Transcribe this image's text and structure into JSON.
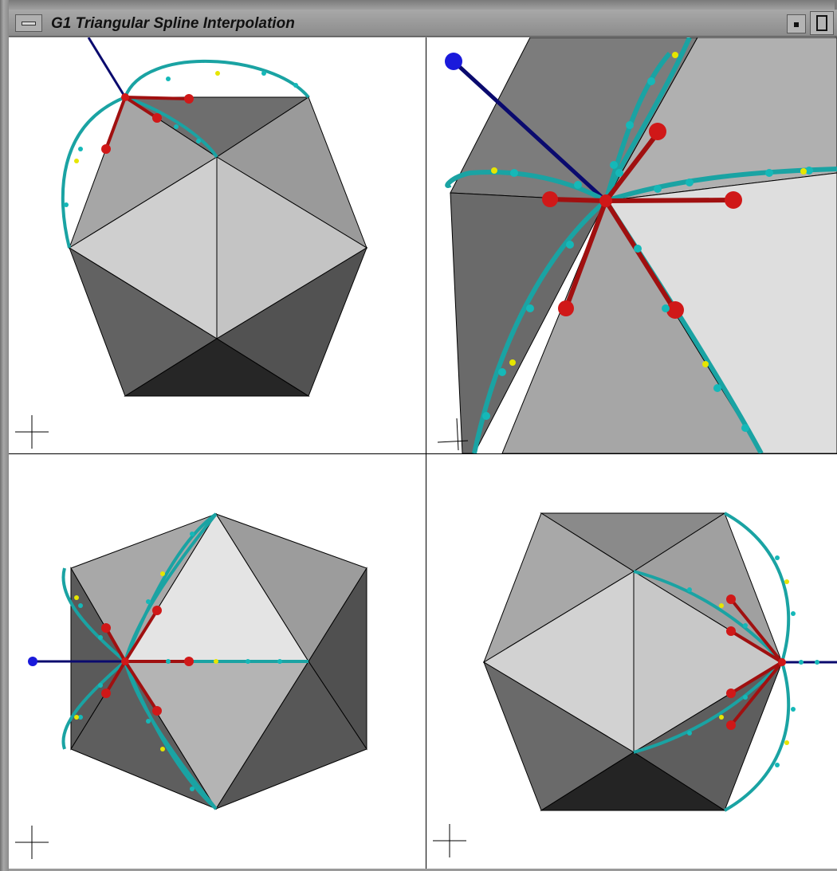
{
  "window": {
    "title": "G1 Triangular Spline Interpolation"
  },
  "icons": {
    "menu": "window-menu-icon",
    "minimize": "minimize-icon",
    "maximize": "maximize-icon",
    "axis": "axis-cross-icon"
  },
  "colors": {
    "curve": "#1aa3a3",
    "curve_point": "#15b8b8",
    "midpoint": "#e6e600",
    "tangent": "#a01010",
    "tangent_end": "#d01818",
    "normal": "#0a0a6e",
    "normal_end": "#1a1adb",
    "outline": "#000000",
    "face_light": "#e4e4e4",
    "face_mid": "#b5b5b5",
    "face_dark": "#5a5a5a",
    "face_darkest": "#262626"
  },
  "viewports": [
    {
      "id": "top-left",
      "view": "front"
    },
    {
      "id": "top-right",
      "view": "close-up"
    },
    {
      "id": "bottom-left",
      "view": "side"
    },
    {
      "id": "bottom-right",
      "view": "opposite-side"
    }
  ]
}
